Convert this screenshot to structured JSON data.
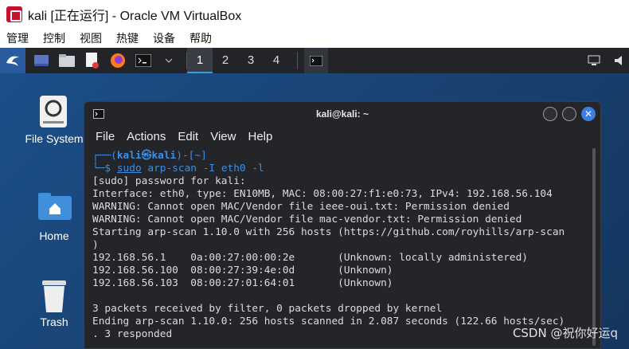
{
  "host": {
    "title": "kali [正在运行] - Oracle VM VirtualBox",
    "menu": [
      "管理",
      "控制",
      "视图",
      "热键",
      "设备",
      "帮助"
    ]
  },
  "panel": {
    "workspaces": [
      "1",
      "2",
      "3",
      "4"
    ],
    "active_workspace": "1"
  },
  "desktop": {
    "icons": [
      {
        "label": "File System",
        "icon": "drive-icon"
      },
      {
        "label": "Home",
        "icon": "home-folder-icon"
      },
      {
        "label": "Trash",
        "icon": "trash-icon"
      }
    ]
  },
  "terminal": {
    "title": "kali@kali: ~",
    "menu": [
      "File",
      "Actions",
      "Edit",
      "View",
      "Help"
    ],
    "prompt_line1_prefix": "┌──(",
    "prompt_user": "kali㉿kali",
    "prompt_line1_suffix": ")-[~]",
    "prompt_line2_prefix": "└─$ ",
    "command_sudo": "sudo",
    "command_rest": " arp-scan -I eth0 -l",
    "output": [
      "[sudo] password for kali:",
      "Interface: eth0, type: EN10MB, MAC: 08:00:27:f1:e0:73, IPv4: 192.168.56.104",
      "WARNING: Cannot open MAC/Vendor file ieee-oui.txt: Permission denied",
      "WARNING: Cannot open MAC/Vendor file mac-vendor.txt: Permission denied",
      "Starting arp-scan 1.10.0 with 256 hosts (https://github.com/royhills/arp-scan",
      ")",
      "192.168.56.1    0a:00:27:00:00:2e       (Unknown: locally administered)",
      "192.168.56.100  08:00:27:39:4e:0d       (Unknown)",
      "192.168.56.103  08:00:27:01:64:01       (Unknown)",
      "",
      "3 packets received by filter, 0 packets dropped by kernel",
      "Ending arp-scan 1.10.0: 256 hosts scanned in 2.087 seconds (122.66 hosts/sec)",
      ". 3 responded"
    ]
  },
  "watermark": "CSDN @祝你好运q"
}
